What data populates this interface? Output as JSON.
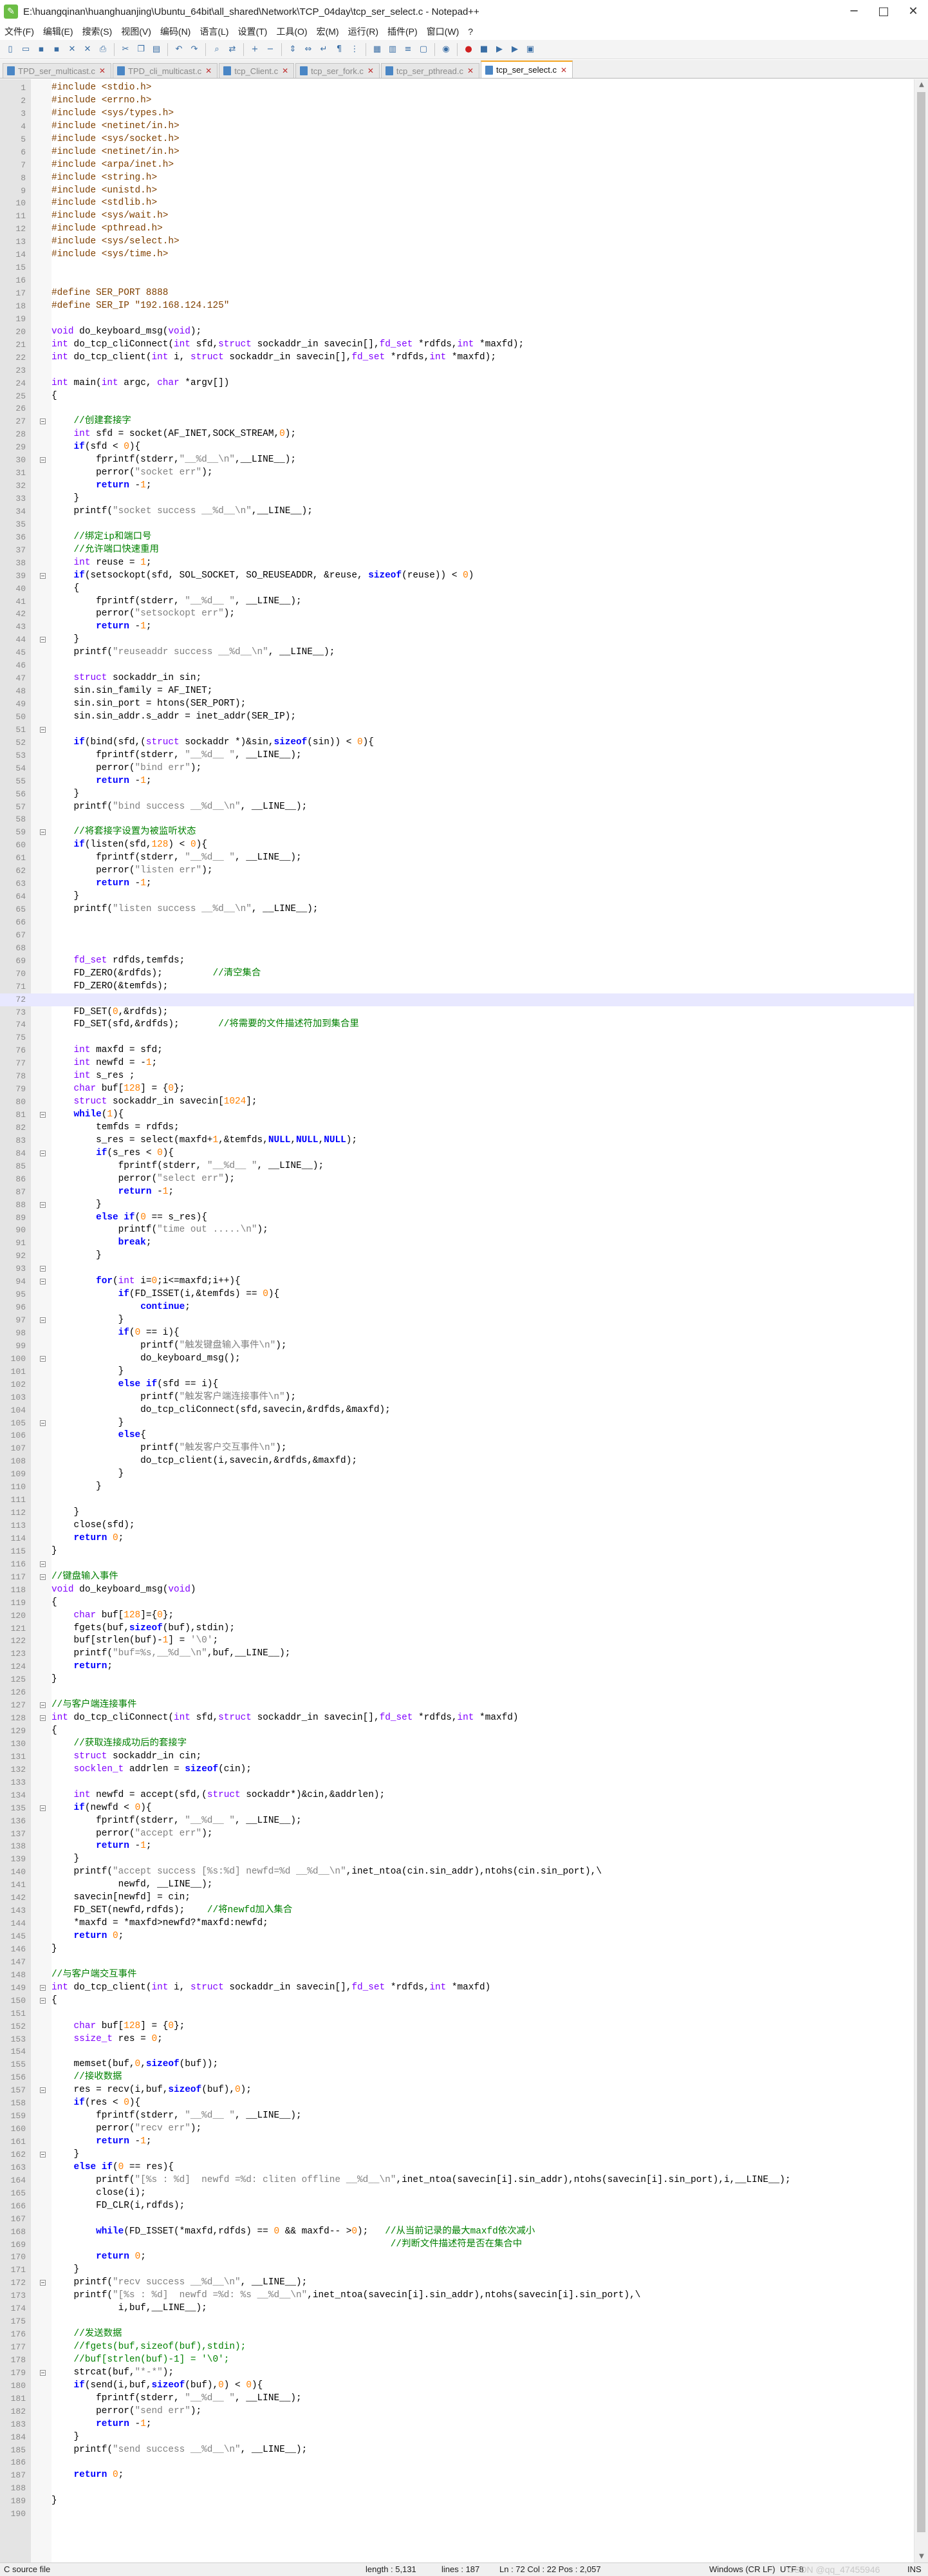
{
  "window": {
    "title": "E:\\huangqinan\\huanghuanjing\\Ubuntu_64bit\\all_shared\\Network\\TCP_04day\\tcp_ser_select.c - Notepad++",
    "app_icon": "notepad-plus-plus-icon",
    "minimize": "─",
    "maximize": "□",
    "close": "✕"
  },
  "menu": [
    "文件(F)",
    "编辑(E)",
    "搜索(S)",
    "视图(V)",
    "编码(N)",
    "语言(L)",
    "设置(T)",
    "工具(O)",
    "宏(M)",
    "运行(R)",
    "插件(P)",
    "窗口(W)",
    "?"
  ],
  "tabs": [
    {
      "label": "TPD_ser_multicast.c",
      "close": "✕",
      "active": false
    },
    {
      "label": "TPD_cli_multicast.c",
      "close": "✕",
      "active": false
    },
    {
      "label": "tcp_Client.c",
      "close": "✕",
      "active": false
    },
    {
      "label": "tcp_ser_fork.c",
      "close": "✕",
      "active": false
    },
    {
      "label": "tcp_ser_pthread.c",
      "close": "✕",
      "active": false
    },
    {
      "label": "tcp_ser_select.c",
      "close": "✕",
      "active": true
    }
  ],
  "editor": {
    "current_line": 72,
    "fold_markers": [
      27,
      30,
      39,
      44,
      51,
      59,
      81,
      84,
      88,
      93,
      94,
      97,
      100,
      105,
      116,
      117,
      127,
      128,
      135,
      149,
      150,
      157,
      162,
      172,
      179
    ],
    "fold_ends": [
      2,
      17,
      33,
      42,
      54,
      62,
      87,
      91,
      96,
      99,
      103,
      108,
      112,
      114,
      124,
      143,
      161,
      171,
      183,
      188
    ],
    "lines": [
      "#include <stdio.h>",
      "#include <errno.h>",
      "#include <sys/types.h>",
      "#include <netinet/in.h>",
      "#include <sys/socket.h>",
      "#include <netinet/in.h>",
      "#include <arpa/inet.h>",
      "#include <string.h>",
      "#include <unistd.h>",
      "#include <stdlib.h>",
      "#include <sys/wait.h>",
      "#include <pthread.h>",
      "#include <sys/select.h>",
      "#include <sys/time.h>",
      "",
      "",
      "#define SER_PORT 8888",
      "#define SER_IP \"192.168.124.125\"",
      "",
      "void do_keyboard_msg(void);",
      "int do_tcp_cliConnect(int sfd,struct sockaddr_in savecin[],fd_set *rdfds,int *maxfd);",
      "int do_tcp_client(int i, struct sockaddr_in savecin[],fd_set *rdfds,int *maxfd);",
      "",
      "int main(int argc, char *argv[])",
      "{",
      "",
      "    //创建套接字",
      "    int sfd = socket(AF_INET,SOCK_STREAM,0);",
      "    if(sfd < 0){",
      "        fprintf(stderr,\"__%d__\\n\",__LINE__);",
      "        perror(\"socket err\");",
      "        return -1;",
      "    }",
      "    printf(\"socket success __%d__\\n\",__LINE__);",
      "",
      "    //绑定ip和端口号",
      "    //允许端口快速重用",
      "    int reuse = 1;",
      "    if(setsockopt(sfd, SOL_SOCKET, SO_REUSEADDR, &reuse, sizeof(reuse)) < 0)",
      "    {",
      "        fprintf(stderr, \"__%d__ \", __LINE__);",
      "        perror(\"setsockopt err\");",
      "        return -1;",
      "    }",
      "    printf(\"reuseaddr success __%d__\\n\", __LINE__);",
      "",
      "    struct sockaddr_in sin;",
      "    sin.sin_family = AF_INET;",
      "    sin.sin_port = htons(SER_PORT);",
      "    sin.sin_addr.s_addr = inet_addr(SER_IP);",
      "",
      "    if(bind(sfd,(struct sockaddr *)&sin,sizeof(sin)) < 0){",
      "        fprintf(stderr, \"__%d__ \", __LINE__);",
      "        perror(\"bind err\");",
      "        return -1;",
      "    }",
      "    printf(\"bind success __%d__\\n\", __LINE__);",
      "",
      "    //将套接字设置为被监听状态",
      "    if(listen(sfd,128) < 0){",
      "        fprintf(stderr, \"__%d__ \", __LINE__);",
      "        perror(\"listen err\");",
      "        return -1;",
      "    }",
      "    printf(\"listen success __%d__\\n\", __LINE__);",
      "",
      "",
      "",
      "    fd_set rdfds,temfds;",
      "    FD_ZERO(&rdfds);         //清空集合",
      "    FD_ZERO(&temfds);",
      "",
      "    FD_SET(0,&rdfds);",
      "    FD_SET(sfd,&rdfds);       //将需要的文件描述符加到集合里",
      "",
      "    int maxfd = sfd;",
      "    int newfd = -1;",
      "    int s_res ;",
      "    char buf[128] = {0};",
      "    struct sockaddr_in savecin[1024];",
      "    while(1){",
      "        temfds = rdfds;",
      "        s_res = select(maxfd+1,&temfds,NULL,NULL,NULL);",
      "        if(s_res < 0){",
      "            fprintf(stderr, \"__%d__ \", __LINE__);",
      "            perror(\"select err\");",
      "            return -1;",
      "        }",
      "        else if(0 == s_res){",
      "            printf(\"time out .....\\n\");",
      "            break;",
      "        }",
      "",
      "        for(int i=0;i<=maxfd;i++){",
      "            if(FD_ISSET(i,&temfds) == 0){",
      "                continue;",
      "            }",
      "            if(0 == i){",
      "                printf(\"触发键盘输入事件\\n\");",
      "                do_keyboard_msg();",
      "            }",
      "            else if(sfd == i){",
      "                printf(\"触发客户端连接事件\\n\");",
      "                do_tcp_cliConnect(sfd,savecin,&rdfds,&maxfd);",
      "            }",
      "            else{",
      "                printf(\"触发客户交互事件\\n\");",
      "                do_tcp_client(i,savecin,&rdfds,&maxfd);",
      "            }",
      "        }",
      "",
      "    }",
      "    close(sfd);",
      "    return 0;",
      "}",
      "",
      "//键盘输入事件",
      "void do_keyboard_msg(void)",
      "{",
      "    char buf[128]={0};",
      "    fgets(buf,sizeof(buf),stdin);",
      "    buf[strlen(buf)-1] = '\\0';",
      "    printf(\"buf=%s,__%d__\\n\",buf,__LINE__);",
      "    return;",
      "}",
      "",
      "//与客户端连接事件",
      "int do_tcp_cliConnect(int sfd,struct sockaddr_in savecin[],fd_set *rdfds,int *maxfd)",
      "{",
      "    //获取连接成功后的套接字",
      "    struct sockaddr_in cin;",
      "    socklen_t addrlen = sizeof(cin);",
      "",
      "    int newfd = accept(sfd,(struct sockaddr*)&cin,&addrlen);",
      "    if(newfd < 0){",
      "        fprintf(stderr, \"__%d__ \", __LINE__);",
      "        perror(\"accept err\");",
      "        return -1;",
      "    }",
      "    printf(\"accept success [%s:%d] newfd=%d __%d__\\n\",inet_ntoa(cin.sin_addr),ntohs(cin.sin_port),\\",
      "            newfd, __LINE__);",
      "    savecin[newfd] = cin;",
      "    FD_SET(newfd,rdfds);    //将newfd加入集合",
      "    *maxfd = *maxfd>newfd?*maxfd:newfd;",
      "    return 0;",
      "}",
      "",
      "//与客户端交互事件",
      "int do_tcp_client(int i, struct sockaddr_in savecin[],fd_set *rdfds,int *maxfd)",
      "{",
      "",
      "    char buf[128] = {0};",
      "    ssize_t res = 0;",
      "",
      "    memset(buf,0,sizeof(buf));",
      "    //接收数据",
      "    res = recv(i,buf,sizeof(buf),0);",
      "    if(res < 0){",
      "        fprintf(stderr, \"__%d__ \", __LINE__);",
      "        perror(\"recv err\");",
      "        return -1;",
      "    }",
      "    else if(0 == res){",
      "        printf(\"[%s : %d]  newfd =%d: cliten offline __%d__\\n\",inet_ntoa(savecin[i].sin_addr),ntohs(savecin[i].sin_port),i,__LINE__);",
      "        close(i);",
      "        FD_CLR(i,rdfds);",
      "",
      "        while(FD_ISSET(*maxfd,rdfds) == 0 && maxfd-- >0);   //从当前记录的最大maxfd依次减小",
      "                                                             //判断文件描述符是否在集合中",
      "        return 0;",
      "    }",
      "    printf(\"recv success __%d__\\n\", __LINE__);",
      "    printf(\"[%s : %d]  newfd =%d: %s __%d__\\n\",inet_ntoa(savecin[i].sin_addr),ntohs(savecin[i].sin_port),\\",
      "            i,buf,__LINE__);",
      "",
      "    //发送数据",
      "    //fgets(buf,sizeof(buf),stdin);",
      "    //buf[strlen(buf)-1] = '\\0';",
      "    strcat(buf,\"*-*\");",
      "    if(send(i,buf,sizeof(buf),0) < 0){",
      "        fprintf(stderr, \"__%d__ \", __LINE__);",
      "        perror(\"send err\");",
      "        return -1;",
      "    }",
      "    printf(\"send success __%d__\\n\", __LINE__);",
      "",
      "    return 0;",
      "",
      "}",
      ""
    ]
  },
  "status": {
    "file_type": "C source file",
    "length": "length : 5,131",
    "lines": "lines : 187",
    "position": "Ln : 72    Col : 22    Pos : 2,057",
    "eol": "Windows (CR LF)",
    "encoding": "UTF-8",
    "mode": "INS"
  },
  "watermark": "CSDN @qq_47455946"
}
